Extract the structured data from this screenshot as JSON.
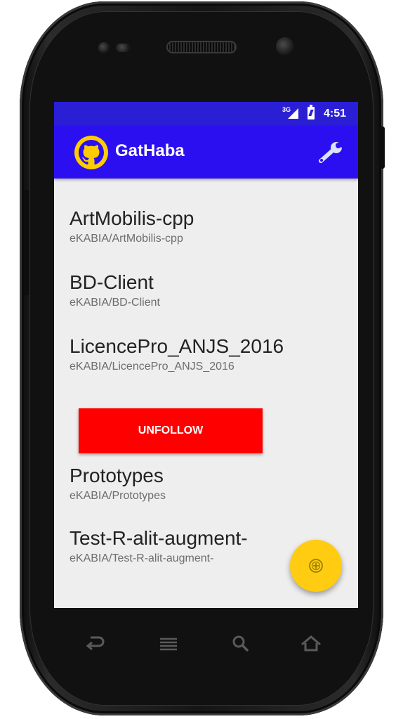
{
  "status_bar": {
    "network": "3G",
    "time": "4:51"
  },
  "app_bar": {
    "title": "GatHaba",
    "logo_icon": "github-octocat-icon",
    "action_icon": "wrench-icon"
  },
  "repos": [
    {
      "name": "ArtMobilis-cpp",
      "path": "eKABIA/ArtMobilis-cpp"
    },
    {
      "name": "BD-Client",
      "path": "eKABIA/BD-Client"
    },
    {
      "name": "LicencePro_ANJS_2016",
      "path": "eKABIA/LicencePro_ANJS_2016"
    },
    {
      "name": "Prototypes",
      "path": "eKABIA/Prototypes"
    },
    {
      "name": "Test-R-alit-augment-",
      "path": "eKABIA/Test-R-alit-augment-"
    }
  ],
  "unfollow_button": {
    "label": "UNFOLLOW"
  },
  "fab": {
    "icon": "add-circle-icon"
  },
  "nav": {
    "back_icon": "back-icon",
    "menu_icon": "menu-icon",
    "search_icon": "search-icon",
    "home_icon": "home-icon"
  },
  "colors": {
    "status_bar": "#2b1fd6",
    "app_bar": "#2b0ff0",
    "accent": "#ffcc11",
    "unfollow": "#ff0000",
    "background": "#eeeeee"
  }
}
